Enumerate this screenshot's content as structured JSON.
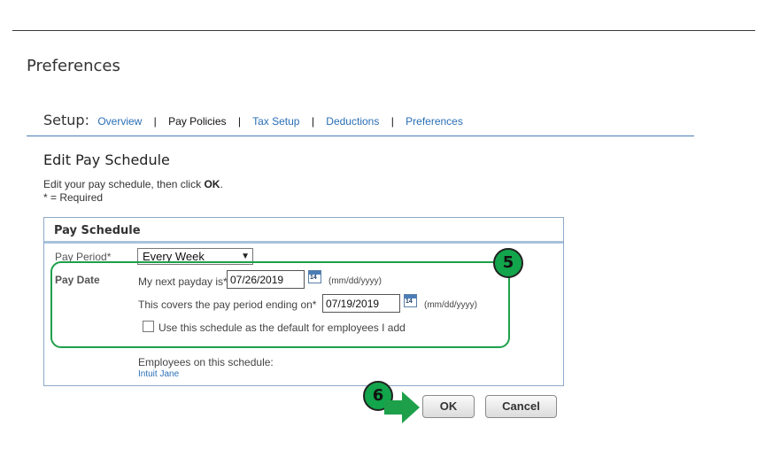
{
  "page": {
    "title": "Preferences"
  },
  "setup_nav": {
    "label": "Setup:",
    "items": [
      {
        "label": "Overview",
        "active": false
      },
      {
        "label": "Pay Policies",
        "active": true
      },
      {
        "label": "Tax Setup",
        "active": false
      },
      {
        "label": "Deductions",
        "active": false
      },
      {
        "label": "Preferences",
        "active": false
      }
    ],
    "separator": "|"
  },
  "section": {
    "title": "Edit Pay Schedule",
    "instruction_prefix": "Edit your pay schedule, then click ",
    "instruction_bold": "OK",
    "instruction_suffix": ".",
    "required_note": "* = Required"
  },
  "panel": {
    "header": "Pay Schedule",
    "pay_period_label": "Pay Period*",
    "pay_period_value": "Every Week",
    "pay_date_label": "Pay Date",
    "next_payday_label": "My next payday is*",
    "next_payday_value": "07/26/2019",
    "date_format": "(mm/dd/yyyy)",
    "period_ending_label": "This covers the pay period ending on*",
    "period_ending_value": "07/19/2019",
    "calendar_day": "14",
    "default_checkbox_label": "Use this schedule as the default for employees I add",
    "default_checked": false,
    "employees_label": "Employees on this schedule:",
    "employees": [
      "Intuit Jane"
    ]
  },
  "callouts": {
    "step5": "5",
    "step6": "6"
  },
  "buttons": {
    "ok": "OK",
    "cancel": "Cancel"
  },
  "colors": {
    "link": "#2a6fb6",
    "callout_green": "#12a54b",
    "panel_border": "#8ea9c8"
  }
}
